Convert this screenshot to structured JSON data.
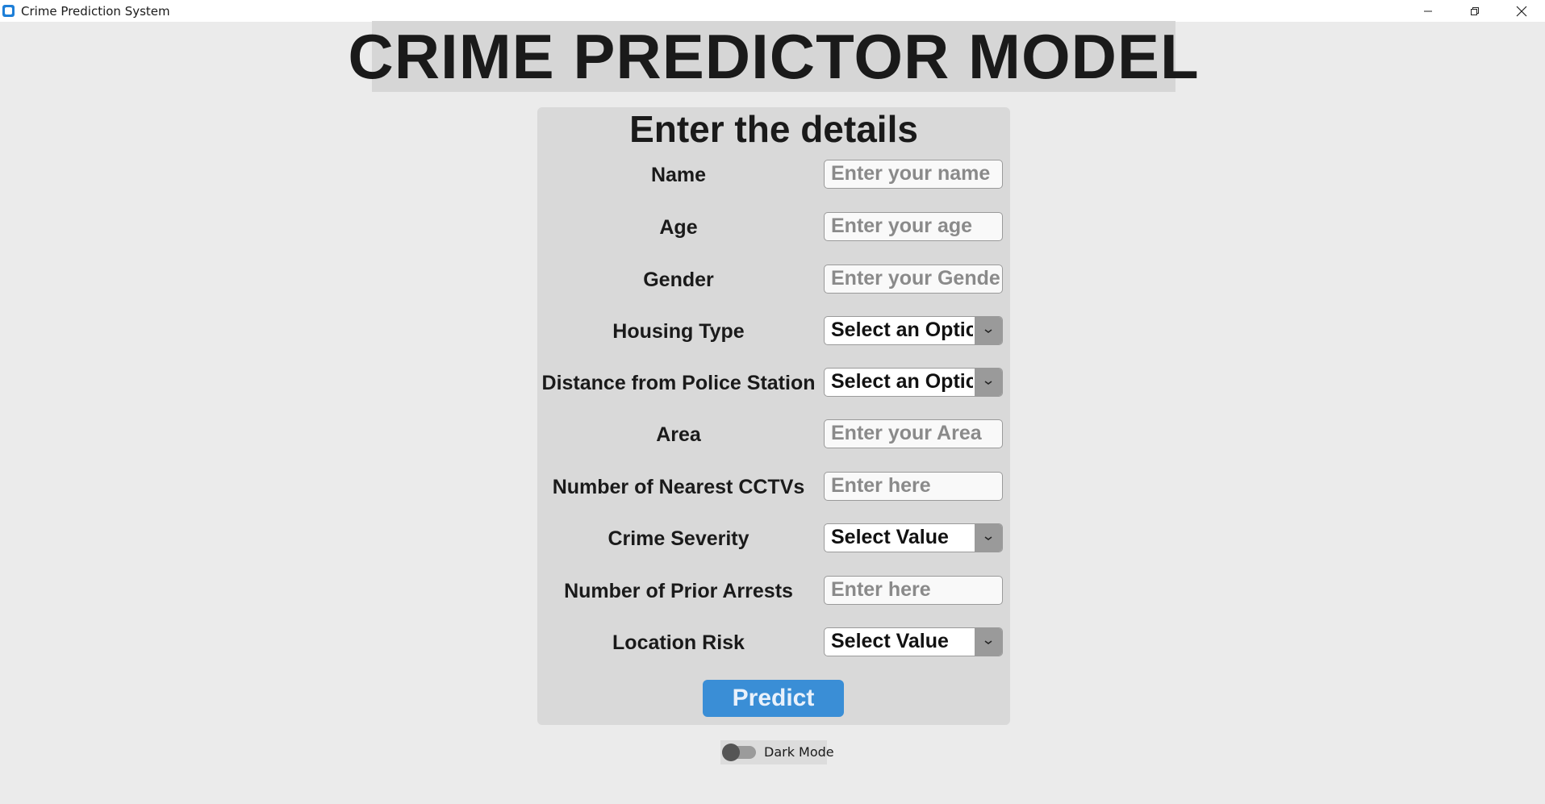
{
  "window": {
    "title": "Crime Prediction System"
  },
  "header": {
    "title": "CRIME PREDICTOR MODEL"
  },
  "form": {
    "heading": "Enter the details",
    "fields": [
      {
        "label": "Name",
        "type": "text",
        "placeholder": "Enter your name"
      },
      {
        "label": "Age",
        "type": "text",
        "placeholder": "Enter your age"
      },
      {
        "label": "Gender",
        "type": "text",
        "placeholder": "Enter your Gende"
      },
      {
        "label": "Housing Type",
        "type": "select",
        "value": "Select an Optic"
      },
      {
        "label": "Distance from Police Station",
        "type": "select",
        "value": "Select an Optic"
      },
      {
        "label": "Area",
        "type": "text",
        "placeholder": "Enter your Area"
      },
      {
        "label": "Number of Nearest CCTVs",
        "type": "text",
        "placeholder": "Enter here"
      },
      {
        "label": "Crime Severity",
        "type": "select",
        "value": "Select Value"
      },
      {
        "label": "Number of Prior Arrests",
        "type": "text",
        "placeholder": "Enter here"
      },
      {
        "label": "Location Risk",
        "type": "select",
        "value": "Select Value"
      }
    ],
    "predict_label": "Predict"
  },
  "dark_mode": {
    "label": "Dark Mode",
    "enabled": false
  },
  "colors": {
    "background": "#ebebeb",
    "card": "#d9d9d9",
    "accent": "#3a8ed6"
  },
  "icons": {
    "app": "app-icon",
    "minimize": "minimize-icon",
    "restore": "restore-icon",
    "close": "close-icon",
    "dropdown": "chevron-down-icon"
  }
}
